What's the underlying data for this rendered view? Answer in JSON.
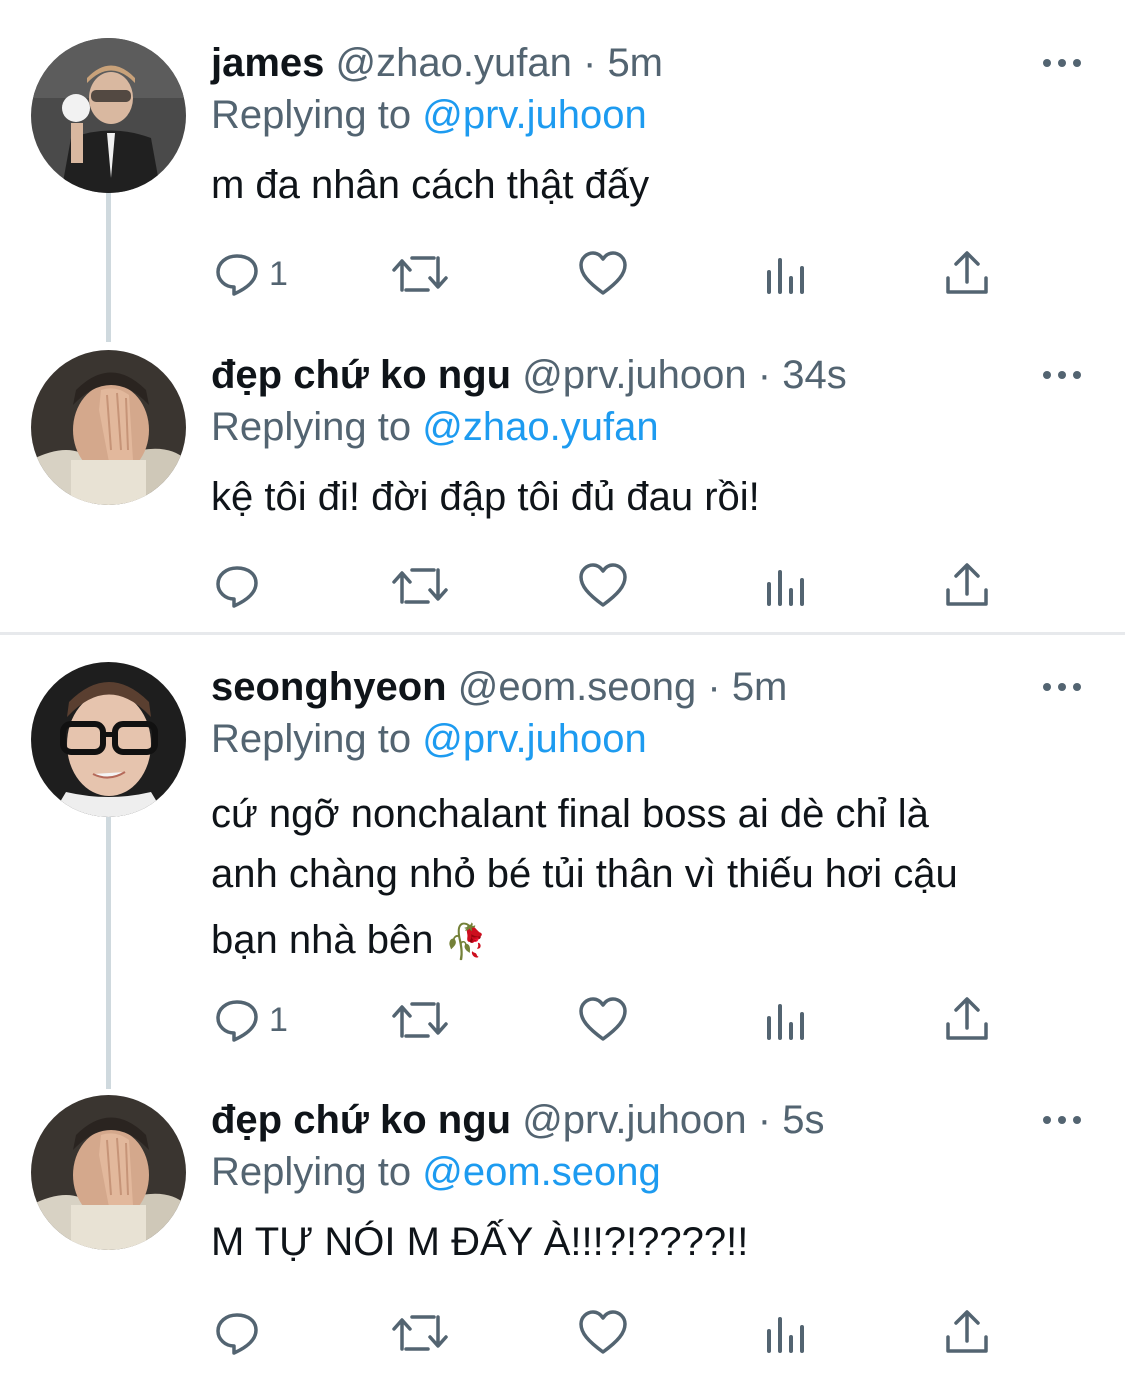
{
  "tweets": [
    {
      "name": "james",
      "handle": "@zhao.yufan",
      "sep": "·",
      "time": "5m",
      "replying_label": "Replying to",
      "replying_to": "@prv.juhoon",
      "text": "m đa nhân cách thật đấy",
      "reply_count": "1"
    },
    {
      "name": "đẹp chứ ko ngu",
      "handle": "@prv.juhoon",
      "sep": "·",
      "time": "34s",
      "replying_label": "Replying to",
      "replying_to": "@zhao.yufan",
      "text": "kệ tôi đi! đời đập tôi đủ đau rồi!",
      "reply_count": ""
    },
    {
      "name": "seonghyeon",
      "handle": "@eom.seong",
      "sep": "·",
      "time": "5m",
      "replying_label": "Replying to",
      "replying_to": "@prv.juhoon",
      "text_lines": [
        "cứ ngỡ nonchalant final boss ai dè chỉ là",
        "anh chàng nhỏ bé tủi thân vì thiếu hơi cậu",
        "bạn nhà bên"
      ],
      "emoji": "🥀",
      "reply_count": "1"
    },
    {
      "name": "đẹp chứ ko ngu",
      "handle": "@prv.juhoon",
      "sep": "·",
      "time": "5s",
      "replying_label": "Replying to",
      "replying_to": "@eom.seong",
      "text": "M TỰ NÓI M ĐẤY À!!!?!????!!",
      "reply_count": ""
    }
  ],
  "icons": {
    "reply": "reply-icon",
    "retweet": "retweet-icon",
    "like": "heart-icon",
    "views": "views-icon",
    "share": "share-icon",
    "more": "more-icon"
  },
  "colors": {
    "text": "#0f1419",
    "secondary": "#536471",
    "mention": "#1d9bf0",
    "connector": "#cfd9de",
    "divider": "#e7e9ec"
  }
}
